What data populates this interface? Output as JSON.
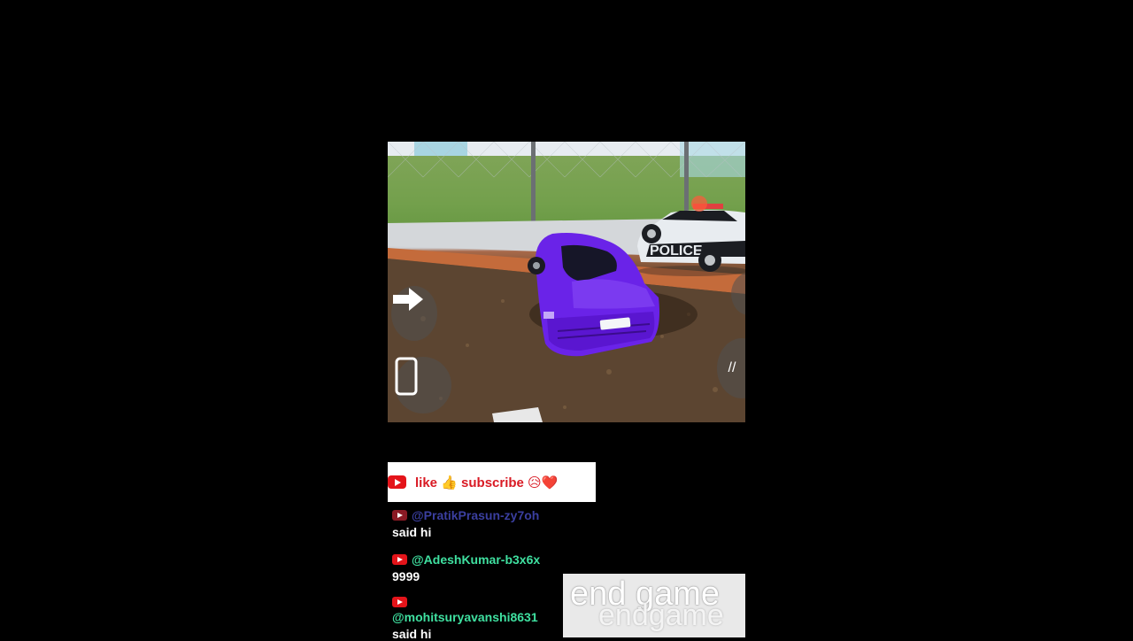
{
  "banner": {
    "text": "like 👍 subscribe 😥❤️"
  },
  "chat": [
    {
      "user": "@PratikPrasun-zy7oh",
      "message": "said hi",
      "color": "#3b3fa0"
    },
    {
      "user": "@AdeshKumar-b3x6x",
      "message": "9999",
      "color": "#3fe0a0"
    },
    {
      "user": "@mohitsuryavanshi8631",
      "message": "said hi",
      "color": "#3fe0a0"
    }
  ],
  "game": {
    "police_text": "POLICE",
    "controls": [
      "arrow-right-icon",
      "phone-icon"
    ]
  },
  "watermark": {
    "text": "end game",
    "text2": "endgame"
  }
}
